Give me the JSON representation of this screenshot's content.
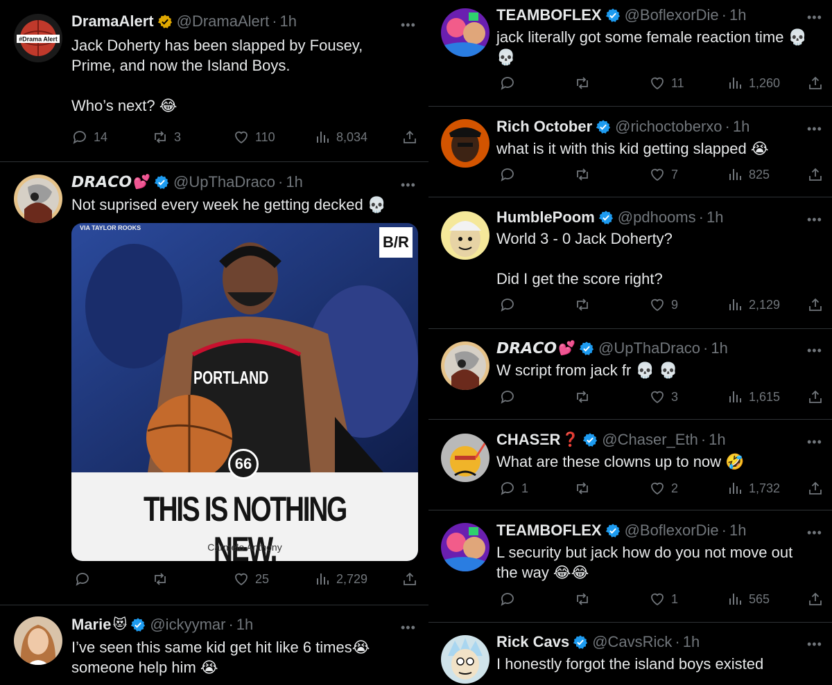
{
  "left": {
    "tweets": [
      {
        "name": "DramaAlert",
        "handle": "@DramaAlert",
        "time": "1h",
        "avatar_text": "#Drama Alert",
        "text": "Jack Doherty has been slapped by Fousey,\nPrime, and now the Island Boys.\n\nWho’s next? 😂",
        "replies": "14",
        "reposts": "3",
        "likes": "110",
        "views": "8,034"
      },
      {
        "name": "𝘿𝙍𝘼𝘾𝙊",
        "name_emoji": "💕",
        "handle": "@UpThaDraco",
        "time": "1h",
        "text": "Not suprised every week he getting decked 💀",
        "media": {
          "via": "VIA TAYLOR ROOKS",
          "logo": "B/R",
          "jersey": "PORTLAND",
          "quote_mark": "66",
          "headline": "THIS IS NOTHING NEW.",
          "author": "Carmelo Anthony"
        },
        "replies": "",
        "reposts": "",
        "likes": "25",
        "views": "2,729"
      },
      {
        "name": "Marie",
        "name_emoji": "😻",
        "handle": "@ickyymar",
        "time": "1h",
        "text": "I’ve seen this same kid get hit like 6 times😭\nsomeone help him 😭"
      }
    ]
  },
  "right": {
    "tweets": [
      {
        "name": "TEAMBOFLEX",
        "handle": "@BoflexorDie",
        "time": "1h",
        "text": "jack literally got some female reaction time 💀\n💀",
        "replies": "",
        "reposts": "",
        "likes": "11",
        "views": "1,260"
      },
      {
        "name": "Rich October",
        "handle": "@richoctoberxo",
        "time": "1h",
        "text": "what is it with this kid getting slapped 😭",
        "replies": "",
        "reposts": "",
        "likes": "7",
        "views": "825"
      },
      {
        "name": "HumblePoom",
        "handle": "@pdhooms",
        "time": "1h",
        "text": "World 3 - 0 Jack Doherty?\n\nDid I get the score right?",
        "replies": "",
        "reposts": "",
        "likes": "9",
        "views": "2,129"
      },
      {
        "name": "𝘿𝙍𝘼𝘾𝙊",
        "name_emoji": "💕",
        "handle": "@UpThaDraco",
        "time": "1h",
        "text": "W script from jack fr 💀 💀",
        "replies": "",
        "reposts": "",
        "likes": "3",
        "views": "1,615"
      },
      {
        "name": "CHASΞR",
        "name_emoji": "❓",
        "handle": "@Chaser_Eth",
        "time": "1h",
        "text": "What are these clowns up to now 🤣",
        "replies": "1",
        "reposts": "",
        "likes": "2",
        "views": "1,732"
      },
      {
        "name": "TEAMBOFLEX",
        "handle": "@BoflexorDie",
        "time": "1h",
        "text": "L security but jack how do you not move out\nthe way 😂😂",
        "replies": "",
        "reposts": "",
        "likes": "1",
        "views": "565"
      },
      {
        "name": "Rick Cavs",
        "handle": "@CavsRick",
        "time": "1h",
        "text": "I honestly forgot the island boys existed"
      }
    ]
  },
  "ui": {
    "dot": "·",
    "more": "•••"
  },
  "colors": {
    "background": "#000000",
    "text": "#e7e9ea",
    "muted": "#71767b",
    "divider": "#2f3336",
    "verified": "#1d9bf0"
  }
}
